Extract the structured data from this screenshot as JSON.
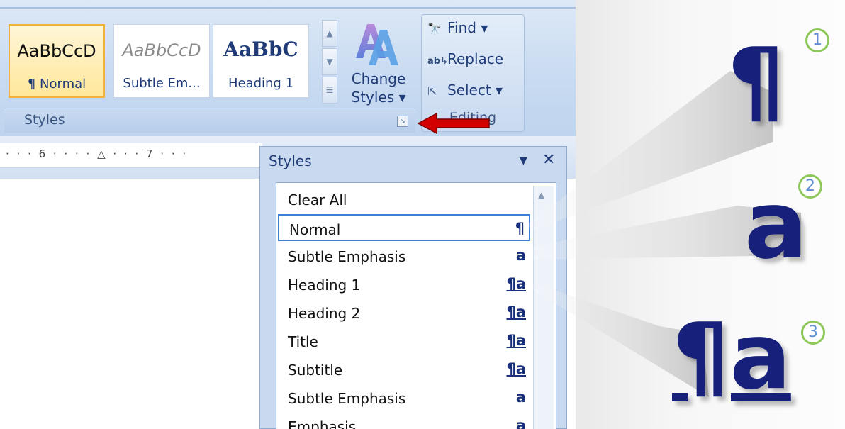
{
  "ribbon": {
    "style_gallery": [
      {
        "sample": "AaBbCcD",
        "name": "¶ Normal",
        "selected": true
      },
      {
        "sample": "AaBbCcD",
        "name": "Subtle Em...",
        "selected": false
      },
      {
        "sample": "AaBbC",
        "name": "Heading 1",
        "selected": false
      }
    ],
    "change_styles": {
      "line1": "Change",
      "line2": "Styles ▾"
    },
    "styles_group_label": "Styles",
    "editing": {
      "find": "Find ▾",
      "replace": "Replace",
      "select": "Select ▾",
      "group_label": "Editing"
    }
  },
  "ruler": {
    "text": "· · · 6 · · · · △ · · · 7 · · ·"
  },
  "styles_pane": {
    "title": "Styles",
    "menu_glyph": "▼",
    "close_glyph": "✕",
    "items": [
      {
        "name": "Clear All",
        "icon": "",
        "underline": false,
        "selected": false
      },
      {
        "name": "Normal",
        "icon": "¶",
        "underline": false,
        "selected": true
      },
      {
        "name": "Subtle Emphasis",
        "icon": "a",
        "underline": false,
        "selected": false
      },
      {
        "name": "Heading 1",
        "icon": "¶a",
        "underline": true,
        "selected": false
      },
      {
        "name": "Heading 2",
        "icon": "¶a",
        "underline": true,
        "selected": false
      },
      {
        "name": "Title",
        "icon": "¶a",
        "underline": true,
        "selected": false
      },
      {
        "name": "Subtitle",
        "icon": "¶a",
        "underline": true,
        "selected": false
      },
      {
        "name": "Subtle Emphasis",
        "icon": "a",
        "underline": false,
        "selected": false
      },
      {
        "name": "Emphasis",
        "icon": "a",
        "underline": false,
        "selected": false
      }
    ]
  },
  "legend": {
    "items": [
      {
        "number": "1",
        "symbol": "¶"
      },
      {
        "number": "2",
        "symbol": "a"
      },
      {
        "number": "3",
        "symbol": "¶a"
      }
    ]
  },
  "colors": {
    "accent_arrow": "#d40000",
    "symbol_navy": "#17207a",
    "badge_ring": "#8ec85a"
  }
}
